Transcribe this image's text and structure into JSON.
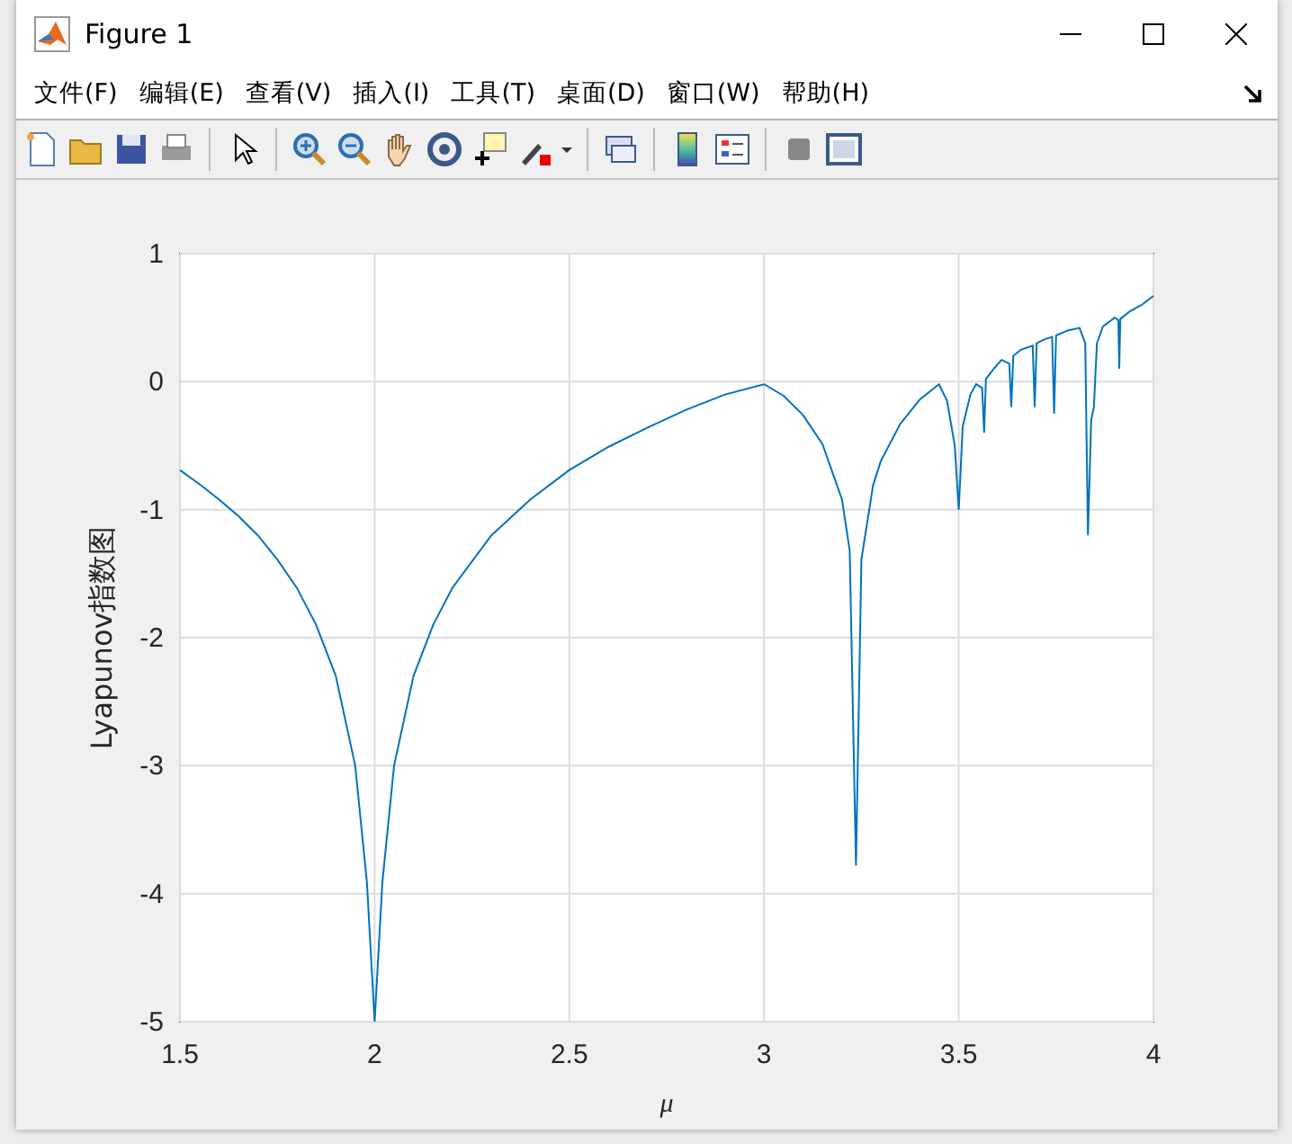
{
  "window": {
    "title": "Figure 1"
  },
  "menu": [
    "文件(F)",
    "编辑(E)",
    "查看(V)",
    "插入(I)",
    "工具(T)",
    "桌面(D)",
    "窗口(W)",
    "帮助(H)"
  ],
  "figure": {
    "chart_data": {
      "type": "line",
      "grid": true,
      "xlabel": "μ",
      "ylabel": "Lyapunov指数图",
      "xlim": [
        1.5,
        4
      ],
      "ylim": [
        -5,
        1
      ],
      "xticks": [
        1.5,
        2,
        2.5,
        3,
        3.5,
        4
      ],
      "yticks": [
        -5,
        -4,
        -3,
        -2,
        -1,
        0,
        1
      ],
      "x": [
        1.5,
        1.55,
        1.6,
        1.65,
        1.7,
        1.75,
        1.8,
        1.85,
        1.9,
        1.95,
        1.98,
        2.0,
        2.02,
        2.05,
        2.1,
        2.15,
        2.2,
        2.3,
        2.4,
        2.5,
        2.6,
        2.7,
        2.8,
        2.9,
        3.0,
        3.05,
        3.1,
        3.15,
        3.2,
        3.22,
        3.236,
        3.25,
        3.28,
        3.3,
        3.35,
        3.4,
        3.449,
        3.47,
        3.49,
        3.5,
        3.51,
        3.53,
        3.545,
        3.56,
        3.565,
        3.57,
        3.59,
        3.61,
        3.63,
        3.635,
        3.64,
        3.66,
        3.69,
        3.695,
        3.7,
        3.72,
        3.74,
        3.745,
        3.75,
        3.78,
        3.81,
        3.825,
        3.832,
        3.84,
        3.847,
        3.855,
        3.87,
        3.9,
        3.91,
        3.912,
        3.915,
        3.94,
        3.97,
        4.0
      ],
      "series": [
        {
          "color": "#0072bd",
          "values": [
            -0.69,
            -0.8,
            -0.92,
            -1.05,
            -1.2,
            -1.39,
            -1.61,
            -1.9,
            -2.3,
            -3.0,
            -3.91,
            -5,
            -3.91,
            -3.0,
            -2.3,
            -1.9,
            -1.61,
            -1.2,
            -0.92,
            -0.69,
            -0.51,
            -0.36,
            -0.22,
            -0.1,
            -0.02,
            -0.11,
            -0.26,
            -0.49,
            -0.92,
            -1.32,
            -3.78,
            -1.39,
            -0.81,
            -0.62,
            -0.33,
            -0.14,
            -0.02,
            -0.15,
            -0.5,
            -1.0,
            -0.35,
            -0.1,
            -0.02,
            -0.05,
            -0.4,
            0.02,
            0.1,
            0.17,
            0.14,
            -0.2,
            0.2,
            0.25,
            0.28,
            -0.2,
            0.3,
            0.33,
            0.35,
            -0.25,
            0.36,
            0.4,
            0.42,
            0.3,
            -1.2,
            -0.3,
            -0.2,
            0.3,
            0.43,
            0.5,
            0.48,
            0.1,
            0.49,
            0.55,
            0.6,
            0.67
          ]
        }
      ]
    }
  }
}
